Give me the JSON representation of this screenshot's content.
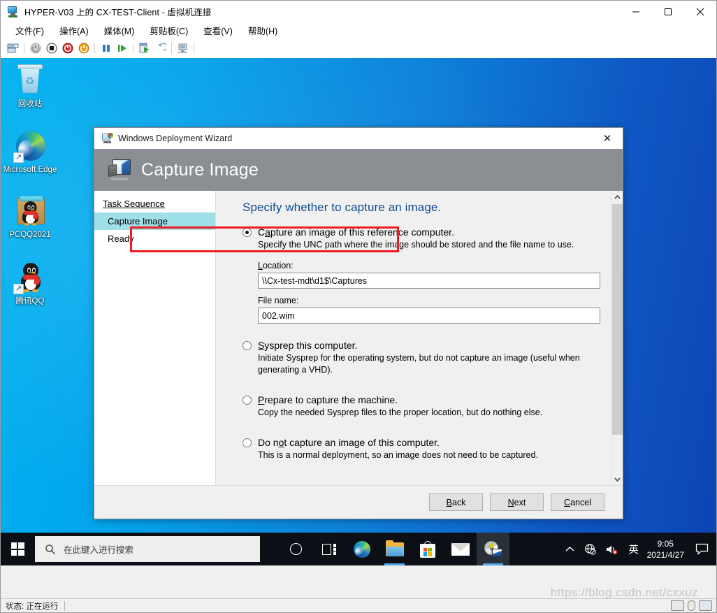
{
  "window": {
    "title": "HYPER-V03 上的 CX-TEST-Client - 虚拟机连接",
    "icon": "virtual-machine-icon",
    "minimize": "—",
    "maximize": "□",
    "close": "✕"
  },
  "menubar": {
    "items": [
      {
        "label": "文件(F)"
      },
      {
        "label": "操作(A)"
      },
      {
        "label": "媒体(M)"
      },
      {
        "label": "剪贴板(C)"
      },
      {
        "label": "查看(V)"
      },
      {
        "label": "帮助(H)"
      }
    ]
  },
  "toolbar": {
    "buttons": [
      {
        "name": "ctrl-alt-del-icon",
        "title": "Ctrl+Alt+Del"
      },
      {
        "name": "power-off-icon",
        "title": "关机"
      },
      {
        "name": "stop-icon",
        "title": "关闭"
      },
      {
        "name": "shutdown-icon",
        "title": "关闭电源"
      },
      {
        "name": "start-icon",
        "title": "启动"
      },
      {
        "name": "pause-icon",
        "title": "暂停"
      },
      {
        "name": "resume-icon",
        "title": "继续"
      },
      {
        "name": "checkpoint-icon",
        "title": "检查点"
      },
      {
        "name": "revert-icon",
        "title": "还原"
      },
      {
        "name": "enhanced-session-icon",
        "title": "增强会话"
      }
    ]
  },
  "desktop": {
    "icons": [
      {
        "label": "回收站",
        "icon": "recycle-bin-icon"
      },
      {
        "label": "Microsoft Edge",
        "icon": "edge-icon"
      },
      {
        "label": "PCQQ2021",
        "icon": "pcqq-folder-icon"
      },
      {
        "label": "腾讯QQ",
        "icon": "qq-icon"
      }
    ]
  },
  "dialog": {
    "title": "Windows Deployment Wizard",
    "title_icon": "deployment-wizard-icon",
    "close_label": "✕",
    "banner": {
      "heading": "Capture Image",
      "icon": "capture-image-icon"
    },
    "nav": {
      "header": "Task Sequence",
      "items": [
        {
          "label": "Capture Image",
          "selected": true
        },
        {
          "label": "Ready",
          "selected": false
        }
      ]
    },
    "page_heading": "Specify whether to capture an image.",
    "options": [
      {
        "label_pre": "C",
        "label_accel": "a",
        "label_post": "pture an image of this reference computer.",
        "full_label": "Capture an image of this reference computer.",
        "description": "Specify the UNC path where the image should be stored and the file name to use.",
        "selected": true,
        "highlighted": true
      },
      {
        "label_pre": "",
        "label_accel": "S",
        "label_post": "ysprep this computer.",
        "full_label": "Sysprep this computer.",
        "description": "Initiate Sysprep for the operating system, but do not capture an image (useful when generating a VHD).",
        "selected": false,
        "highlighted": false
      },
      {
        "label_pre": "",
        "label_accel": "P",
        "label_post": "repare to capture the machine.",
        "full_label": "Prepare to capture the machine.",
        "description": "Copy the needed Sysprep files to the proper location, but do nothing else.",
        "selected": false,
        "highlighted": false
      },
      {
        "label_pre": "Do n",
        "label_accel": "o",
        "label_post": "t capture an image of this computer.",
        "full_label": "Do not capture an image of this computer.",
        "description": "This is a normal deployment, so an image does not need to be captured.",
        "selected": false,
        "highlighted": false
      }
    ],
    "fields": {
      "location_label_pre": "",
      "location_label_accel": "L",
      "location_label_post": "ocation:",
      "location_value": "\\\\Cx-test-mdt\\d1$\\Captures",
      "filename_label": "File name:",
      "filename_value": "002.wim"
    },
    "buttons": [
      {
        "pre": "",
        "accel": "B",
        "post": "ack",
        "full": "Back",
        "name": "back-button"
      },
      {
        "pre": "",
        "accel": "N",
        "post": "ext",
        "full": "Next",
        "name": "next-button"
      },
      {
        "pre": "",
        "accel": "C",
        "post": "ancel",
        "full": "Cancel",
        "name": "cancel-button"
      }
    ],
    "scrollbar": {
      "up": "⌃",
      "down": "⌄"
    },
    "highlight_color": "#ee1c22"
  },
  "taskbar": {
    "start_label": "开始",
    "search_placeholder": "在此键入进行搜索",
    "search_icon": "search-icon",
    "items": [
      {
        "name": "cortana-icon",
        "label": "Cortana"
      },
      {
        "name": "task-view-icon",
        "label": "任务视图"
      },
      {
        "name": "edge-taskbar-icon",
        "label": "Microsoft Edge"
      },
      {
        "name": "file-explorer-icon",
        "label": "文件资源管理器"
      },
      {
        "name": "microsoft-store-icon",
        "label": "Microsoft Store"
      },
      {
        "name": "mail-icon",
        "label": "邮件"
      },
      {
        "name": "vmconnect-icon",
        "label": "虚拟机连接"
      }
    ],
    "tray": {
      "chevron": "⌃",
      "network_icon": "network-globe-icon",
      "volume_icon": "volume-muted-icon",
      "ime": "英",
      "time": "9:05",
      "date": "2021/4/27",
      "notification_icon": "notification-icon"
    }
  },
  "statusbar": {
    "text": "状态: 正在运行",
    "right_icons": [
      {
        "name": "keyboard-indicator-icon"
      },
      {
        "name": "mouse-indicator-icon"
      },
      {
        "name": "network-indicator-icon"
      }
    ]
  },
  "watermark": "https://blog.csdn.net/cxxuz"
}
